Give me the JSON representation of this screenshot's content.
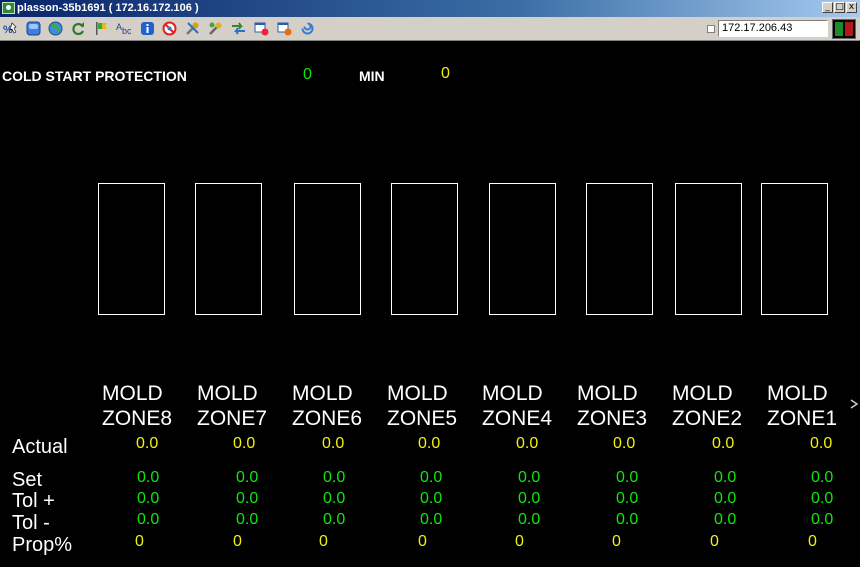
{
  "window": {
    "title": "plasson-35b1691 ( 172.16.172.106 )",
    "controls": [
      "minimize",
      "maximize",
      "close"
    ]
  },
  "toolbar": {
    "icons": [
      "cursor-key-icon",
      "blue-box-icon",
      "globe-icon",
      "refresh-icon",
      "flag-icon",
      "spell-check-icon",
      "info-icon",
      "forbidden-icon",
      "tools-icon",
      "tools2-icon",
      "arrows-icon",
      "window-pin-icon",
      "window-pin2-icon",
      "swirl-icon"
    ],
    "ip_address": "172.17.206.43",
    "status_colors": {
      "left": "#1d8b2a",
      "right": "#b3191a"
    }
  },
  "header": {
    "cold_start_label": "COLD START PROTECTION",
    "cold_start_value": "0",
    "min_label": "MIN",
    "min_value": "0"
  },
  "zones": [
    {
      "line1": "MOLD",
      "line2": "ZONE8",
      "actual": "0.0",
      "set": "0.0",
      "tol_plus": "0.0",
      "tol_minus": "0.0",
      "prop": "0"
    },
    {
      "line1": "MOLD",
      "line2": "ZONE7",
      "actual": "0.0",
      "set": "0.0",
      "tol_plus": "0.0",
      "tol_minus": "0.0",
      "prop": "0"
    },
    {
      "line1": "MOLD",
      "line2": "ZONE6",
      "actual": "0.0",
      "set": "0.0",
      "tol_plus": "0.0",
      "tol_minus": "0.0",
      "prop": "0"
    },
    {
      "line1": "MOLD",
      "line2": "ZONE5",
      "actual": "0.0",
      "set": "0.0",
      "tol_plus": "0.0",
      "tol_minus": "0.0",
      "prop": "0"
    },
    {
      "line1": "MOLD",
      "line2": "ZONE4",
      "actual": "0.0",
      "set": "0.0",
      "tol_plus": "0.0",
      "tol_minus": "0.0",
      "prop": "0"
    },
    {
      "line1": "MOLD",
      "line2": "ZONE3",
      "actual": "0.0",
      "set": "0.0",
      "tol_plus": "0.0",
      "tol_minus": "0.0",
      "prop": "0"
    },
    {
      "line1": "MOLD",
      "line2": "ZONE2",
      "actual": "0.0",
      "set": "0.0",
      "tol_plus": "0.0",
      "tol_minus": "0.0",
      "prop": "0"
    },
    {
      "line1": "MOLD",
      "line2": "ZONE1",
      "actual": "0.0",
      "set": "0.0",
      "tol_plus": "0.0",
      "tol_minus": "0.0",
      "prop": "0"
    }
  ],
  "row_labels": {
    "actual": "Actual",
    "set": "Set",
    "tol_plus": "Tol +",
    "tol_minus": "Tol -",
    "prop": "Prop%"
  },
  "colors": {
    "actual": "#f2f20a",
    "set": "#0ee80e",
    "tolerance": "#0ee80e",
    "prop": "#f2f20a"
  }
}
